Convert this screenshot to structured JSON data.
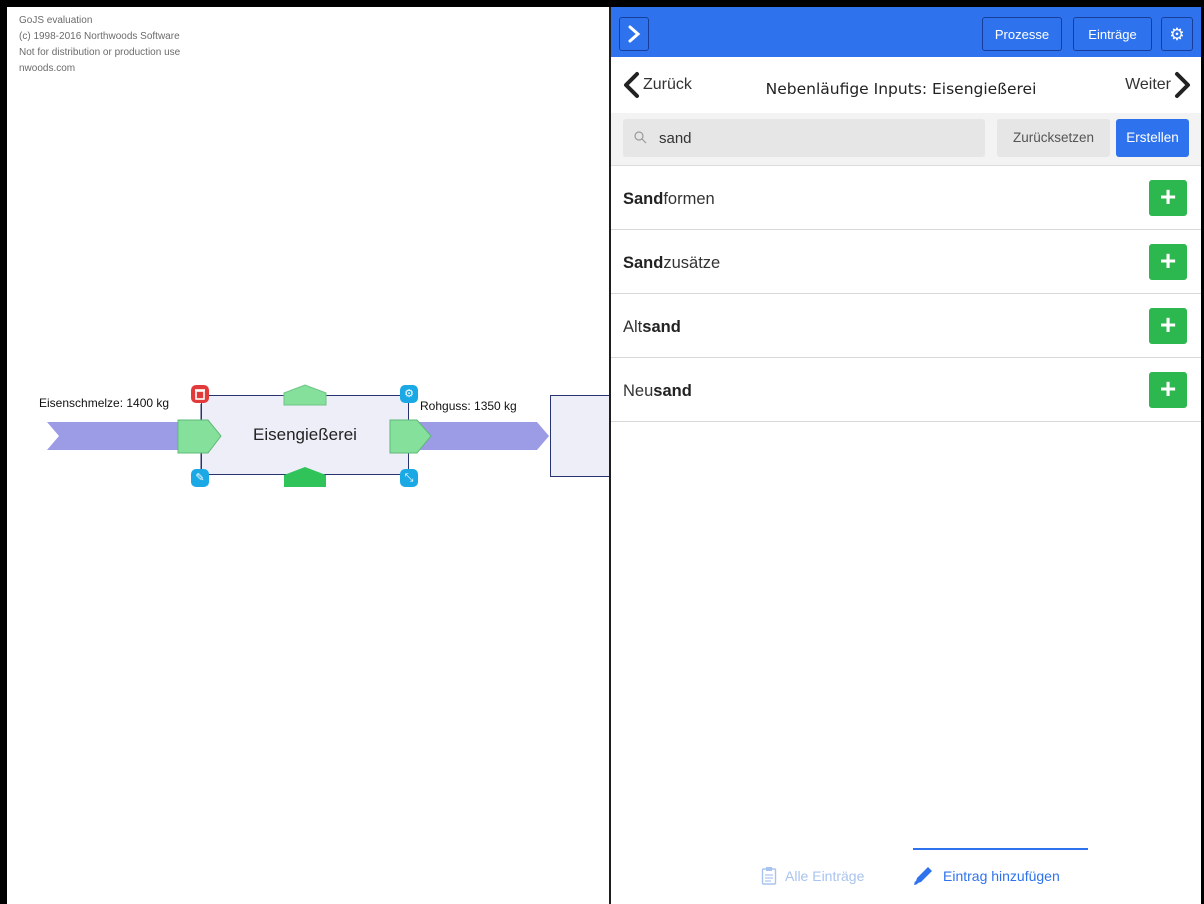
{
  "watermark": {
    "line1": "GoJS evaluation",
    "line2": "(c) 1998-2016 Northwoods Software",
    "line3": "Not for distribution or production use",
    "line4": "nwoods.com"
  },
  "diagram": {
    "input_label": "Eisenschmelze: 1400 kg",
    "output_label": "Rohguss: 1350 kg",
    "node_title": "Eisengießerei",
    "handle_icons": [
      "trash-icon",
      "gear-icon",
      "pencil-icon",
      "resize-icon"
    ]
  },
  "topbar": {
    "toggle_icon": "chevron-right-icon",
    "buttons": [
      "Prozesse",
      "Einträge"
    ],
    "settings_icon": "gear-icon"
  },
  "navbar": {
    "back_label": "Zurück",
    "title": "Nebenläufige Inputs: Eisengießerei",
    "forward_label": "Weiter"
  },
  "search": {
    "value": "sand",
    "reset_label": "Zurücksetzen",
    "create_label": "Erstellen"
  },
  "results": [
    {
      "match": "Sand",
      "rest": "formen",
      "match_first": true
    },
    {
      "match": "Sand",
      "rest": "zusätze",
      "match_first": true
    },
    {
      "pre": "Alt",
      "match": "sand",
      "match_first": false
    },
    {
      "pre": "Neu",
      "match": "sand",
      "match_first": false
    }
  ],
  "bottom_tabs": {
    "all_entries": "Alle Einträge",
    "add_entry": "Eintrag hinzufügen"
  },
  "colors": {
    "primary": "#2e73ed",
    "add_green": "#2db84f",
    "flow_arrow": "#9b9be6",
    "port_green": "#85e09c"
  }
}
